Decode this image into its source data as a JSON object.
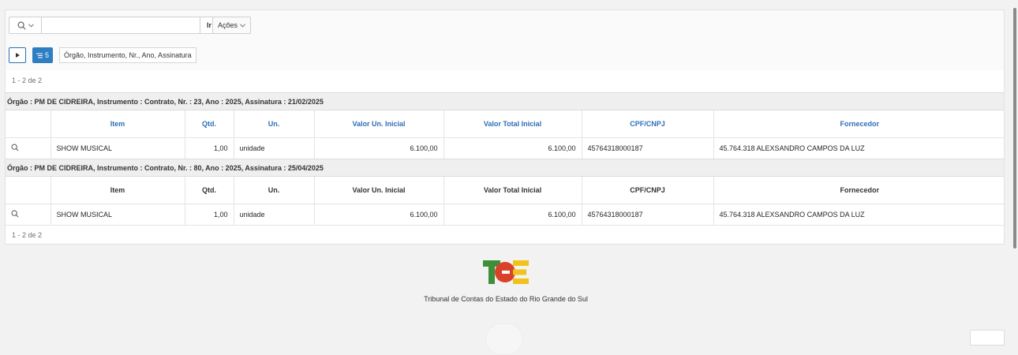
{
  "toolbar": {
    "search_icon": "search-icon",
    "search_placeholder": "",
    "go_label": "Ir",
    "actions_label": "Ações"
  },
  "filter": {
    "badge_count": "5",
    "control_break_label": "Órgão, Instrumento, Nr., Ano, Assinatura"
  },
  "pagination": {
    "top": "1 - 2 de 2",
    "bottom": "1 - 2 de 2"
  },
  "groups": [
    {
      "break_label": "Órgão : PM DE CIDREIRA, Instrumento : Contrato, Nr. : 23, Ano : 2025, Assinatura : 21/02/2025",
      "headers": [
        "Item",
        "Qtd.",
        "Un.",
        "Valor Un. Inicial",
        "Valor Total Inicial",
        "CPF/CNPJ",
        "Fornecedor"
      ],
      "row": {
        "item": "SHOW MUSICAL",
        "qtd": "1,00",
        "un": "unidade",
        "valor_un": "6.100,00",
        "valor_total": "6.100,00",
        "cpf_cnpj": "45764318000187",
        "fornecedor": "45.764.318 ALEXSANDRO CAMPOS DA LUZ"
      }
    },
    {
      "break_label": "Órgão : PM DE CIDREIRA, Instrumento : Contrato, Nr. : 80, Ano : 2025, Assinatura : 25/04/2025",
      "headers": [
        "Item",
        "Qtd.",
        "Un.",
        "Valor Un. Inicial",
        "Valor Total Inicial",
        "CPF/CNPJ",
        "Fornecedor"
      ],
      "row": {
        "item": "SHOW MUSICAL",
        "qtd": "1,00",
        "un": "unidade",
        "valor_un": "6.100,00",
        "valor_total": "6.100,00",
        "cpf_cnpj": "45764318000187",
        "fornecedor": "45.764.318 ALEXSANDRO CAMPOS DA LUZ"
      }
    }
  ],
  "footer": {
    "institution": "Tribunal de Contas do Estado do Rio Grande do Sul",
    "logo_text": "TCE"
  },
  "colors": {
    "header_link": "#2e6eb8",
    "badge": "#2e7ec2",
    "logo_green": "#3f8f3a",
    "logo_red": "#d9412b",
    "logo_yellow": "#f1c21b"
  }
}
